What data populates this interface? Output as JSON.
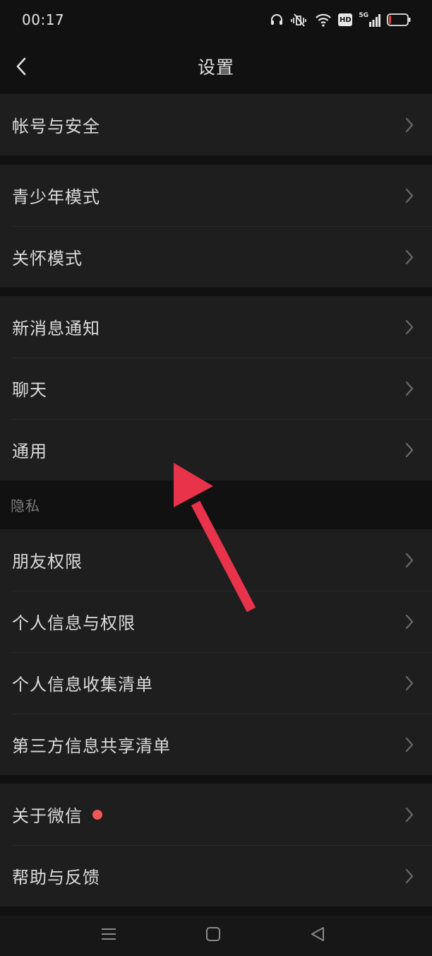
{
  "status_bar": {
    "time": "00:17",
    "icons": [
      "headphones-icon",
      "mute-vibrate-icon",
      "wifi-icon",
      "hd-icon",
      "signal-5g-icon",
      "battery-low-icon"
    ],
    "hd_label": "HD",
    "network_label": "5G",
    "battery_level": 0.12,
    "battery_color": "#e0443e"
  },
  "header": {
    "title": "设置",
    "back_icon": "chevron-left-icon"
  },
  "groups": [
    {
      "items": [
        {
          "label": "帐号与安全"
        }
      ]
    },
    {
      "items": [
        {
          "label": "青少年模式"
        },
        {
          "label": "关怀模式"
        }
      ]
    },
    {
      "items": [
        {
          "label": "新消息通知"
        },
        {
          "label": "聊天"
        },
        {
          "label": "通用"
        }
      ]
    },
    {
      "section": "隐私",
      "items": [
        {
          "label": "朋友权限"
        },
        {
          "label": "个人信息与权限"
        },
        {
          "label": "个人信息收集清单"
        },
        {
          "label": "第三方信息共享清单"
        }
      ]
    },
    {
      "items": [
        {
          "label": "关于微信",
          "badge": "red-dot"
        },
        {
          "label": "帮助与反馈"
        }
      ]
    }
  ],
  "annotation": {
    "icon": "red-arrow-annotation",
    "color": "#e8334a"
  },
  "nav_bar": {
    "icons": [
      "menu-icon",
      "home-square-icon",
      "back-triangle-icon"
    ]
  },
  "colors": {
    "background": "#111111",
    "row_background": "#1e1e1e",
    "text": "#dcdcdc",
    "section_text": "#7c7c7c",
    "badge": "#f25555"
  }
}
